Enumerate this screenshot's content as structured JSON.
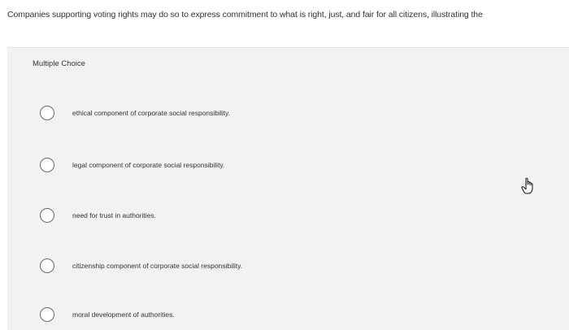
{
  "question": {
    "text": "Companies supporting voting rights may do so to express commitment to what is right, just, and fair for all citizens, illustrating the"
  },
  "panel": {
    "header": "Multiple Choice"
  },
  "options": [
    {
      "label": "ethical component of corporate social responsibility.",
      "selected": false
    },
    {
      "label": "legal component of corporate social responsibility.",
      "selected": false
    },
    {
      "label": "need for trust in authorities.",
      "selected": false
    },
    {
      "label": "citizenship component of corporate social responsibility.",
      "selected": false
    },
    {
      "label": "moral development of authorities.",
      "selected": false
    }
  ],
  "cursor": {
    "icon": "hand-pointer-icon"
  }
}
